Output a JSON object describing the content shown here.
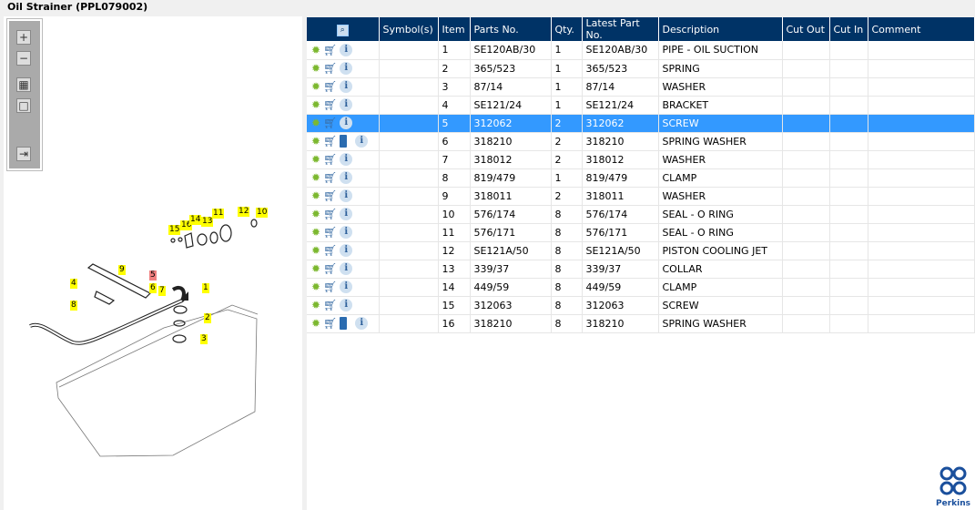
{
  "title": "Oil Strainer (PPL079002)",
  "toolbar": {
    "zoom_in": "+",
    "zoom_out": "−",
    "fit": "▦",
    "actual": "□",
    "layout": "⇥"
  },
  "callouts": [
    {
      "n": "15",
      "hl": false
    },
    {
      "n": "16",
      "hl": false
    },
    {
      "n": "14",
      "hl": false
    },
    {
      "n": "13",
      "hl": false
    },
    {
      "n": "11",
      "hl": false
    },
    {
      "n": "12",
      "hl": false
    },
    {
      "n": "10",
      "hl": false
    },
    {
      "n": "9",
      "hl": false
    },
    {
      "n": "4",
      "hl": false
    },
    {
      "n": "5",
      "hl": true
    },
    {
      "n": "6",
      "hl": false
    },
    {
      "n": "7",
      "hl": false
    },
    {
      "n": "1",
      "hl": false
    },
    {
      "n": "8",
      "hl": false
    },
    {
      "n": "2",
      "hl": false
    },
    {
      "n": "3",
      "hl": false
    }
  ],
  "columns": [
    "",
    "Symbol(s)",
    "Item",
    "Parts No.",
    "Qty.",
    "Latest Part No.",
    "Description",
    "Cut Out",
    "Cut In",
    "Comment"
  ],
  "rows": [
    {
      "item": "1",
      "part": "SE120AB/30",
      "qty": "1",
      "latest": "SE120AB/30",
      "desc": "PIPE - OIL SUCTION",
      "book": false
    },
    {
      "item": "2",
      "part": "365/523",
      "qty": "1",
      "latest": "365/523",
      "desc": "SPRING",
      "book": false
    },
    {
      "item": "3",
      "part": "87/14",
      "qty": "1",
      "latest": "87/14",
      "desc": "WASHER",
      "book": false
    },
    {
      "item": "4",
      "part": "SE121/24",
      "qty": "1",
      "latest": "SE121/24",
      "desc": "BRACKET",
      "book": false
    },
    {
      "item": "5",
      "part": "312062",
      "qty": "2",
      "latest": "312062",
      "desc": "SCREW",
      "book": false,
      "selected": true
    },
    {
      "item": "6",
      "part": "318210",
      "qty": "2",
      "latest": "318210",
      "desc": "SPRING WASHER",
      "book": true
    },
    {
      "item": "7",
      "part": "318012",
      "qty": "2",
      "latest": "318012",
      "desc": "WASHER",
      "book": false
    },
    {
      "item": "8",
      "part": "819/479",
      "qty": "1",
      "latest": "819/479",
      "desc": "CLAMP",
      "book": false
    },
    {
      "item": "9",
      "part": "318011",
      "qty": "2",
      "latest": "318011",
      "desc": "WASHER",
      "book": false
    },
    {
      "item": "10",
      "part": "576/174",
      "qty": "8",
      "latest": "576/174",
      "desc": "SEAL - O RING",
      "book": false
    },
    {
      "item": "11",
      "part": "576/171",
      "qty": "8",
      "latest": "576/171",
      "desc": "SEAL - O RING",
      "book": false
    },
    {
      "item": "12",
      "part": "SE121A/50",
      "qty": "8",
      "latest": "SE121A/50",
      "desc": "PISTON COOLING JET",
      "book": false
    },
    {
      "item": "13",
      "part": "339/37",
      "qty": "8",
      "latest": "339/37",
      "desc": "COLLAR",
      "book": false
    },
    {
      "item": "14",
      "part": "449/59",
      "qty": "8",
      "latest": "449/59",
      "desc": "CLAMP",
      "book": false
    },
    {
      "item": "15",
      "part": "312063",
      "qty": "8",
      "latest": "312063",
      "desc": "SCREW",
      "book": false
    },
    {
      "item": "16",
      "part": "318210",
      "qty": "8",
      "latest": "318210",
      "desc": "SPRING WASHER",
      "book": true
    }
  ],
  "logo": "Perkins",
  "colors": {
    "header": "#003366",
    "selected": "#3399ff",
    "callout": "#ffff00",
    "callout_highlight": "#f08080"
  }
}
